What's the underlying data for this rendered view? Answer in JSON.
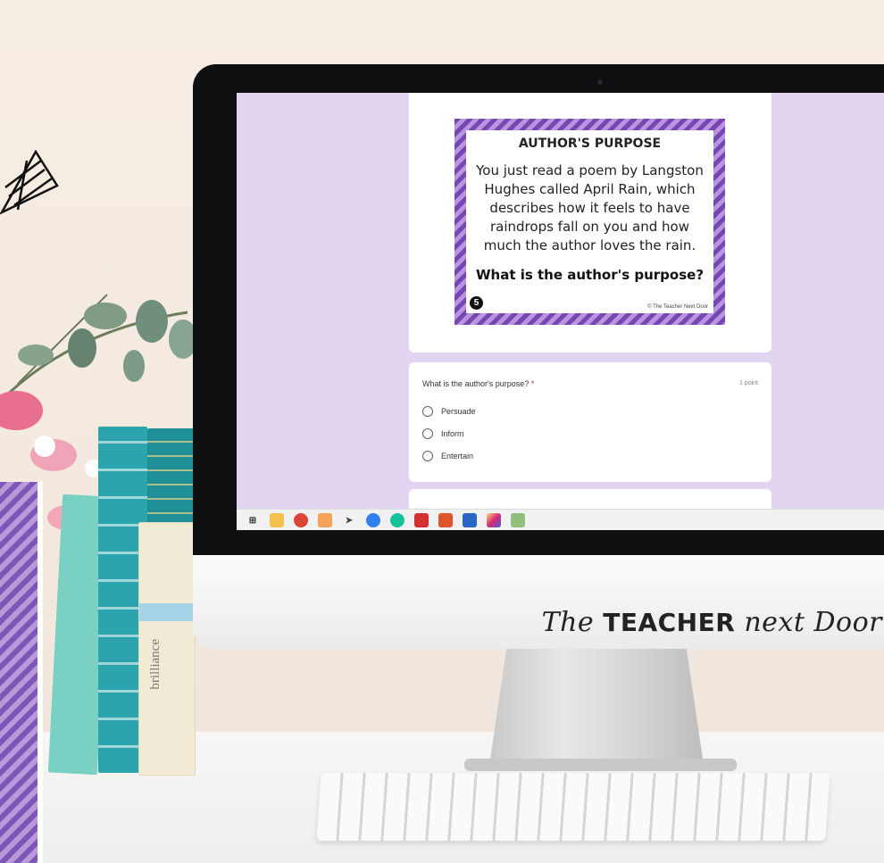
{
  "task_card": {
    "title": "AUTHOR'S PURPOSE",
    "body": "You just read a poem by Langston Hughes called April Rain, which describes how it feels to have raindrops fall on you and how much the author loves the rain.",
    "question": "What is the author's purpose?",
    "number": "5",
    "copyright": "© The Teacher Next Door"
  },
  "form": {
    "question": "What is the author's purpose?",
    "required_mark": "*",
    "points": "1 point",
    "options": [
      "Persuade",
      "Inform",
      "Entertain"
    ]
  },
  "brand": {
    "the": "The",
    "teacher": "TEACHER",
    "next": "next",
    "door": "Door"
  },
  "book_spine": "brilliance",
  "taskbar": {
    "icons": [
      "task-view-icon",
      "file-explorer-icon",
      "chrome-icon",
      "zoom-icon",
      "arrow-app-icon",
      "circle-app-icon",
      "grammarly-icon",
      "acrobat-icon",
      "powerpoint-icon",
      "word-icon",
      "instagram-icon",
      "image-app-icon"
    ]
  },
  "colors": {
    "form_background": "#e2d5f2",
    "card_stripe": "#7646b2",
    "required": "#d93025"
  }
}
